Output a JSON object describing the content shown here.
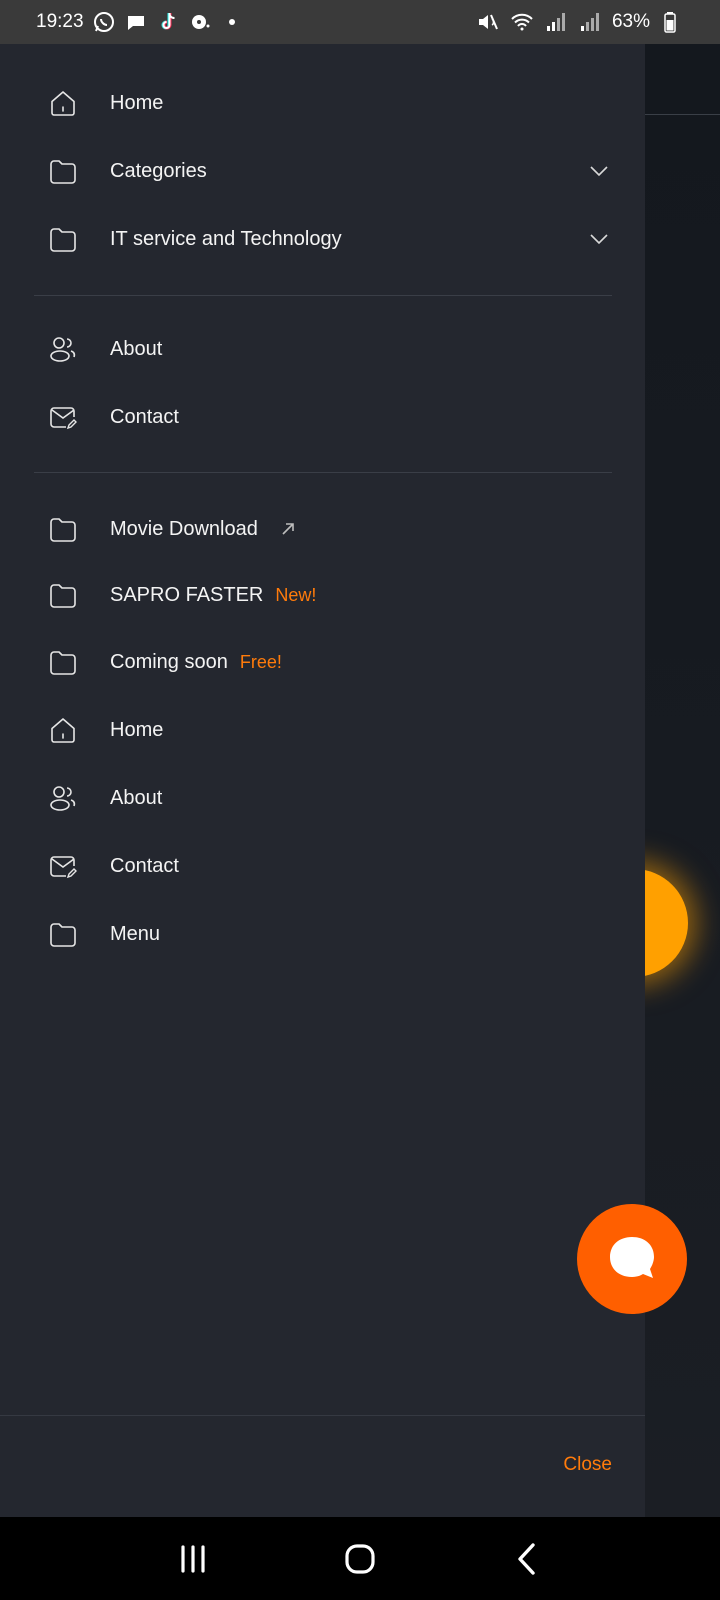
{
  "status_bar": {
    "time": "19:23",
    "battery": "63%",
    "left_icons": [
      "whatsapp-icon",
      "chat-bubble-icon",
      "tiktok-icon",
      "podcast-icon",
      "dot-icon"
    ],
    "right_icons": [
      "mute-icon",
      "wifi-icon",
      "signal-icon",
      "signal-icon",
      "battery-icon"
    ]
  },
  "drawer": {
    "section1": [
      {
        "label": "Home",
        "icon": "home-icon"
      },
      {
        "label": "Categories",
        "icon": "folder-icon",
        "expandable": true
      },
      {
        "label": "IT service and Technology",
        "icon": "folder-icon",
        "expandable": true
      }
    ],
    "section2": [
      {
        "label": "About",
        "icon": "users-icon"
      },
      {
        "label": "Contact",
        "icon": "mail-icon"
      }
    ],
    "section3": [
      {
        "label": "Movie Download",
        "icon": "folder-icon",
        "external": true
      },
      {
        "label": "SAPRO FASTER",
        "icon": "folder-icon",
        "badge": "New!"
      },
      {
        "label": "Coming soon",
        "icon": "folder-icon",
        "badge": "Free!"
      },
      {
        "label": "Home",
        "icon": "home-icon"
      },
      {
        "label": "About",
        "icon": "users-icon"
      },
      {
        "label": "Contact",
        "icon": "mail-icon"
      },
      {
        "label": "Menu",
        "icon": "folder-icon"
      }
    ],
    "close_label": "Close"
  },
  "colors": {
    "accent": "#ff7b0b",
    "drawer_bg": "#24272f",
    "fab": "#ff5f00"
  }
}
